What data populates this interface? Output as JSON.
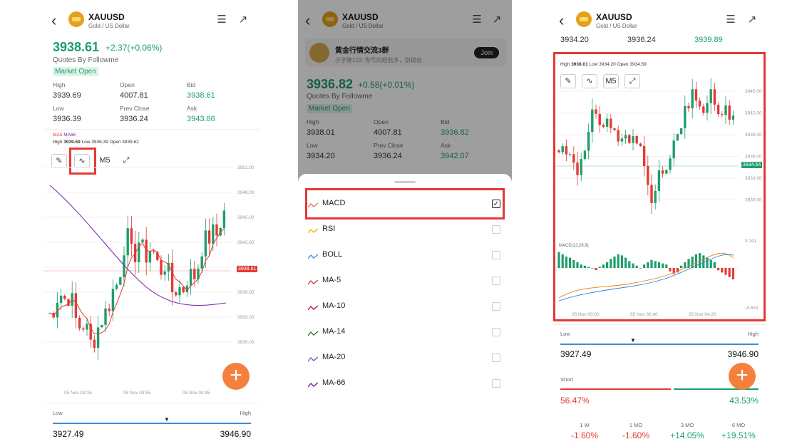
{
  "symbol": "XAUUSD",
  "subtitle": "Gold / US Dollar",
  "quotes_by": "Quotes By Followme",
  "market_status": "Market Open",
  "labels": {
    "high": "High",
    "open": "Open",
    "bid": "Bid",
    "low": "Low",
    "prev_close": "Prev Close",
    "ask": "Ask"
  },
  "colors": {
    "up": "#1e9e6b",
    "down": "#e53935",
    "fab": "#f5803e",
    "highlight": "#e53935",
    "ma5": "#e53935",
    "ma66": "#7b1fa2"
  },
  "screen1": {
    "price": "3938.61",
    "change": "+2.37(+0.06%)",
    "high": "3939.69",
    "open": "4007.81",
    "bid": "3938.61",
    "low": "3936.39",
    "prev_close": "3936.24",
    "ask": "3943.86",
    "ma_legend": {
      "ma5": "MA5",
      "ma66": "MA66"
    },
    "chart_info": {
      "high_label": "High",
      "high": "3939.69",
      "low_label": "Low",
      "low": "3936.39",
      "open_label": "Open",
      "open": "3939.62"
    },
    "toolbar": {
      "period": "M5"
    },
    "y_labels": [
      "3951.00",
      "3948.00",
      "3945.00",
      "3942.00",
      "3939.00",
      "3936.00",
      "3933.00",
      "3930.00"
    ],
    "price_tag": "3938.61",
    "x_labels": [
      "05 Nov 03:15",
      "05 Nov 03:55",
      "05 Nov 04:35"
    ],
    "range": {
      "low_label": "Low",
      "high_label": "High",
      "low": "3927.49",
      "high": "3946.90"
    }
  },
  "screen2": {
    "price": "3936.82",
    "change": "+0.58(+0.01%)",
    "high": "3938.01",
    "open": "4007.81",
    "bid": "3936.82",
    "low": "3934.20",
    "prev_close": "3936.24",
    "ask": "3942.07",
    "banner": {
      "title": "黄金行情交流3群",
      "message": "小学建123: 你亏的经验多，别说话",
      "join": "Join"
    },
    "indicators": [
      {
        "name": "MACD",
        "icon": "macd-icon",
        "checked": true
      },
      {
        "name": "RSI",
        "icon": "rsi-icon",
        "checked": false
      },
      {
        "name": "BOLL",
        "icon": "boll-icon",
        "checked": false
      },
      {
        "name": "MA-5",
        "icon": "ma5-icon",
        "checked": false
      },
      {
        "name": "MA-10",
        "icon": "ma10-icon",
        "checked": false
      },
      {
        "name": "MA-14",
        "icon": "ma14-icon",
        "checked": false
      },
      {
        "name": "MA-20",
        "icon": "ma20-icon",
        "checked": false
      },
      {
        "name": "MA-66",
        "icon": "ma66-icon",
        "checked": false
      }
    ]
  },
  "screen3": {
    "top_row": [
      "3934.20",
      "3936.24",
      "3939.89"
    ],
    "chart_info": {
      "high_label": "High",
      "high": "3938.01",
      "low_label": "Low",
      "low": "3934.20",
      "open_label": "Open",
      "open": "3934.59"
    },
    "toolbar": {
      "period": "M5"
    },
    "y_labels": [
      "3945.00",
      "3942.00",
      "3939.00",
      "3936.00",
      "3933.00",
      "3930.00"
    ],
    "price_tag": "3934.64",
    "macd_label": "MACD(12,26,9)",
    "macd_top": "3.191",
    "macd_bottom": "-4.659",
    "x_labels": [
      "05 Nov 00:00",
      "05 Nov 02:40",
      "05 Nov 04:20"
    ],
    "range": {
      "low_label": "Low",
      "high_label": "High",
      "low": "3927.49",
      "high": "3946.90"
    },
    "sentiment": {
      "short_label": "Short",
      "short": "56.47%",
      "long": "43.53%",
      "short_fraction": 0.5647
    },
    "performance": [
      {
        "label": "1 W",
        "value": "-1.60%"
      },
      {
        "label": "1 MO",
        "value": "-1.60%"
      },
      {
        "label": "3 MO",
        "value": "+14.05%"
      },
      {
        "label": "6 MO",
        "value": "+19.51%"
      }
    ]
  }
}
